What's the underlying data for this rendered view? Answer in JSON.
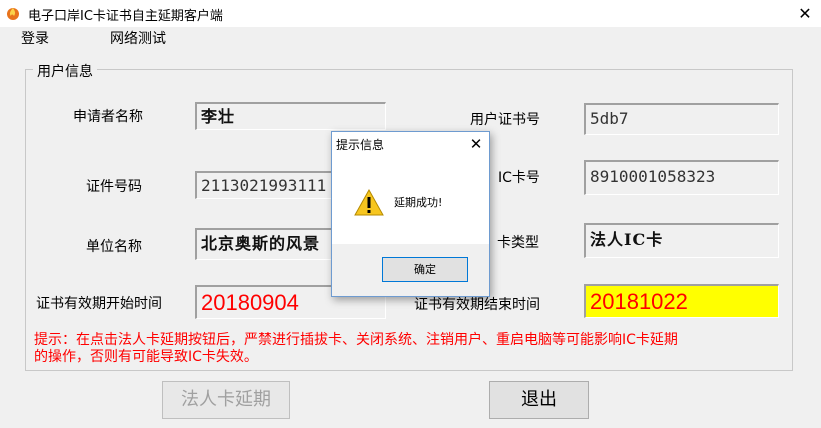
{
  "window": {
    "title": "电子口岸IC卡证书自主延期客户端",
    "close_glyph": "✕",
    "icon": "app-flame-icon"
  },
  "menu": {
    "items": [
      "登录",
      "网络测试"
    ]
  },
  "group": {
    "title": "用户信息"
  },
  "form": {
    "applicant_name_label": "申请者名称",
    "applicant_name": "李壮",
    "cert_number_label": "证件号码",
    "cert_number": "2113021993111",
    "unit_name_label": "单位名称",
    "unit_name": "北京奥斯的风景",
    "user_cert_label": "用户证书号",
    "user_cert": "5db7",
    "ic_card_label": "IC卡号",
    "ic_card": "8910001058323",
    "card_type_label": "卡类型",
    "card_type": "法人IC卡",
    "start_label": "证书有效期开始时间",
    "start_date": "20180904",
    "end_label": "证书有效期结束时间",
    "end_date": "20181022"
  },
  "warning": {
    "line1": "提示：在点击法人卡延期按钮后，严禁进行插拔卡、关闭系统、注销用户、重启电脑等可能影响IC卡延期",
    "line2": "的操作，否则有可能导致IC卡失效。"
  },
  "buttons": {
    "extend": "法人卡延期",
    "exit": "退出"
  },
  "dialog": {
    "title": "提示信息",
    "close_glyph": "✕",
    "message": "延期成功!",
    "ok": "确定",
    "icon": "warning-icon"
  },
  "colors": {
    "warning_text": "#ff0000",
    "date_text": "#ff0000",
    "end_date_bg": "#ffff00",
    "dialog_border": "#6e9bd0",
    "ok_border": "#0078d7"
  }
}
